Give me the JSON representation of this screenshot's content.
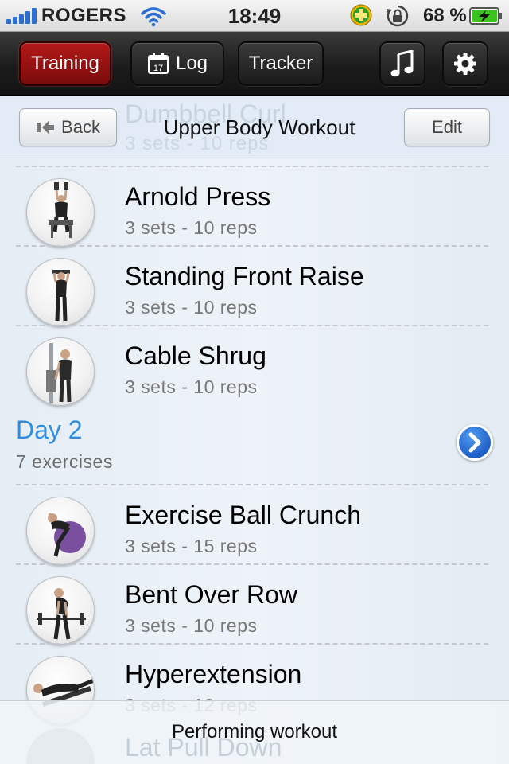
{
  "status_bar": {
    "carrier": "ROGERS",
    "time": "18:49",
    "battery": "68 %"
  },
  "toolbar": {
    "training_label": "Training",
    "log_label": "Log",
    "log_calendar_day": "17",
    "tracker_label": "Tracker",
    "music_icon": "music-note-icon",
    "settings_icon": "gear-icon",
    "active_color": "#9a1210"
  },
  "header": {
    "back_label": "Back",
    "title": "Upper Body Workout",
    "edit_label": "Edit",
    "scrolled_item_name": "Dumbbell Curl",
    "scrolled_item_sets": "3 sets - 10 reps"
  },
  "day1_exercises": [
    {
      "name": "Arnold Press",
      "sets": "3 sets - 10 reps"
    },
    {
      "name": "Standing Front Raise",
      "sets": "3 sets - 10 reps"
    },
    {
      "name": "Cable Shrug",
      "sets": "3 sets - 10 reps"
    }
  ],
  "day2": {
    "title": "Day 2",
    "count": "7 exercises",
    "accent": "#2f8de0"
  },
  "day2_exercises": [
    {
      "name": "Exercise Ball Crunch",
      "sets": "3 sets - 15 reps"
    },
    {
      "name": "Bent Over Row",
      "sets": "3 sets - 10 reps"
    },
    {
      "name": "Hyperextension",
      "sets": "3 sets - 12 reps"
    }
  ],
  "bottom": {
    "label": "Performing workout",
    "scrolled_item_name": "Lat Pull Down"
  }
}
